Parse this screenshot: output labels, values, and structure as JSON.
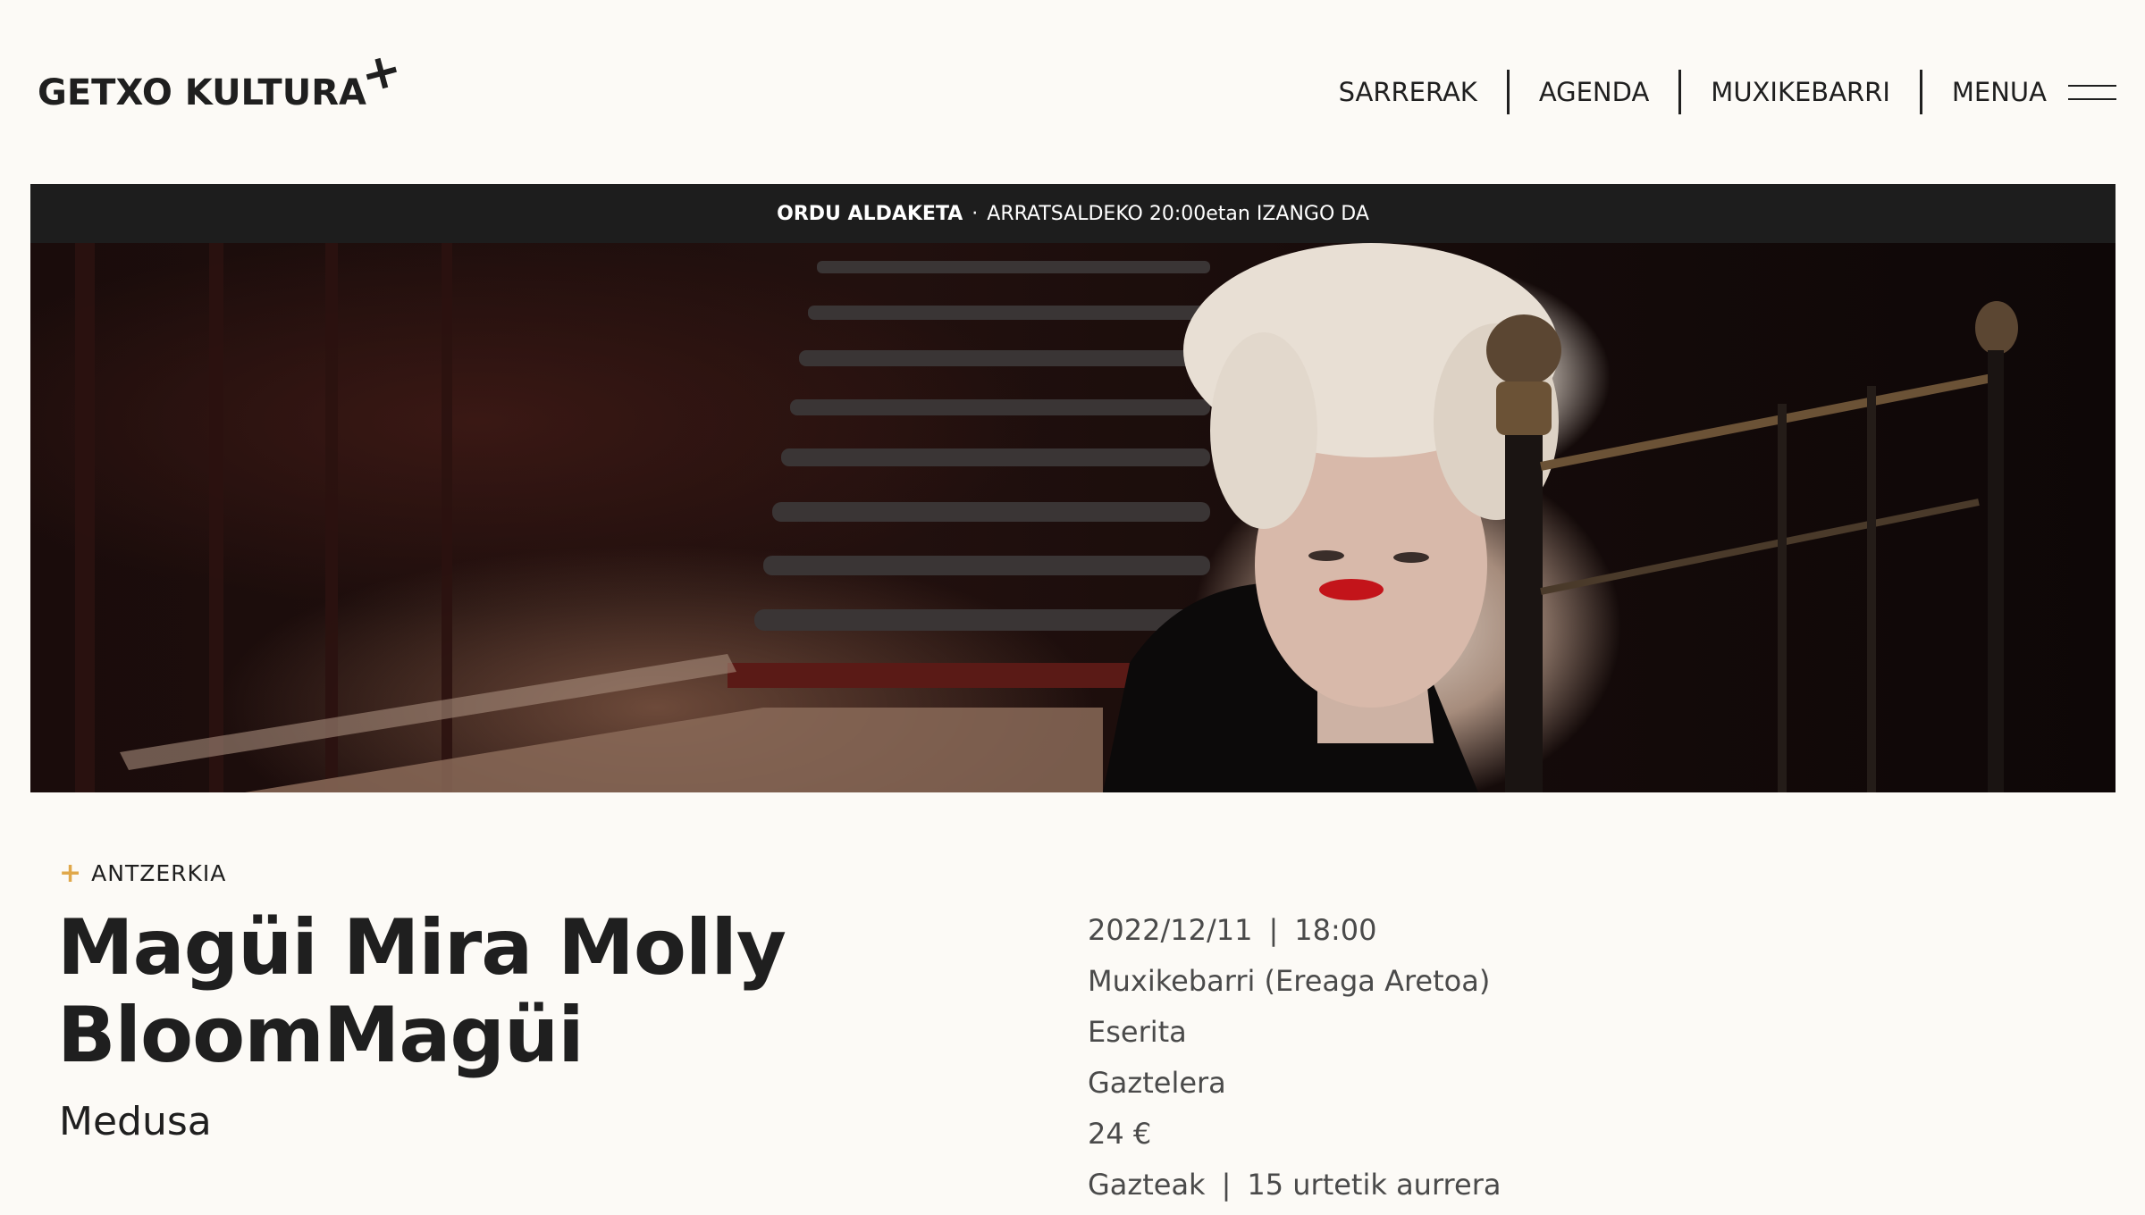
{
  "header": {
    "logo_text": "GETXO KULTURA",
    "logo_mark": "+",
    "nav": [
      "SARRERAK",
      "AGENDA",
      "MUXIKEBARRI",
      "MENUA"
    ],
    "menu_icon": "hamburger-icon"
  },
  "notice": {
    "label": "ORDU ALDAKETA",
    "separator": "·",
    "text": "ARRATSALDEKO 20:00etan IZANGO DA"
  },
  "hero": {
    "image": "photo of woman with white curly hair and red lipstick beside brass bed frame in dark theater"
  },
  "event": {
    "category": "ANTZERKIA",
    "title": "Magüi Mira Molly BloomMagüi",
    "company": "Medusa",
    "date": "2022/12/11",
    "time": "18:00",
    "venue": "Muxikebarri (Ereaga Aretoa)",
    "seating": "Eserita",
    "language": "Gaztelera",
    "price": "24 €",
    "audience": "Gazteak",
    "age": "15 urtetik aurrera",
    "pipe": "|"
  },
  "colors": {
    "background": "#fcfaf6",
    "text": "#1f1f1f",
    "notice_bg": "#1d1d1d",
    "accent": "#e0a84a"
  }
}
